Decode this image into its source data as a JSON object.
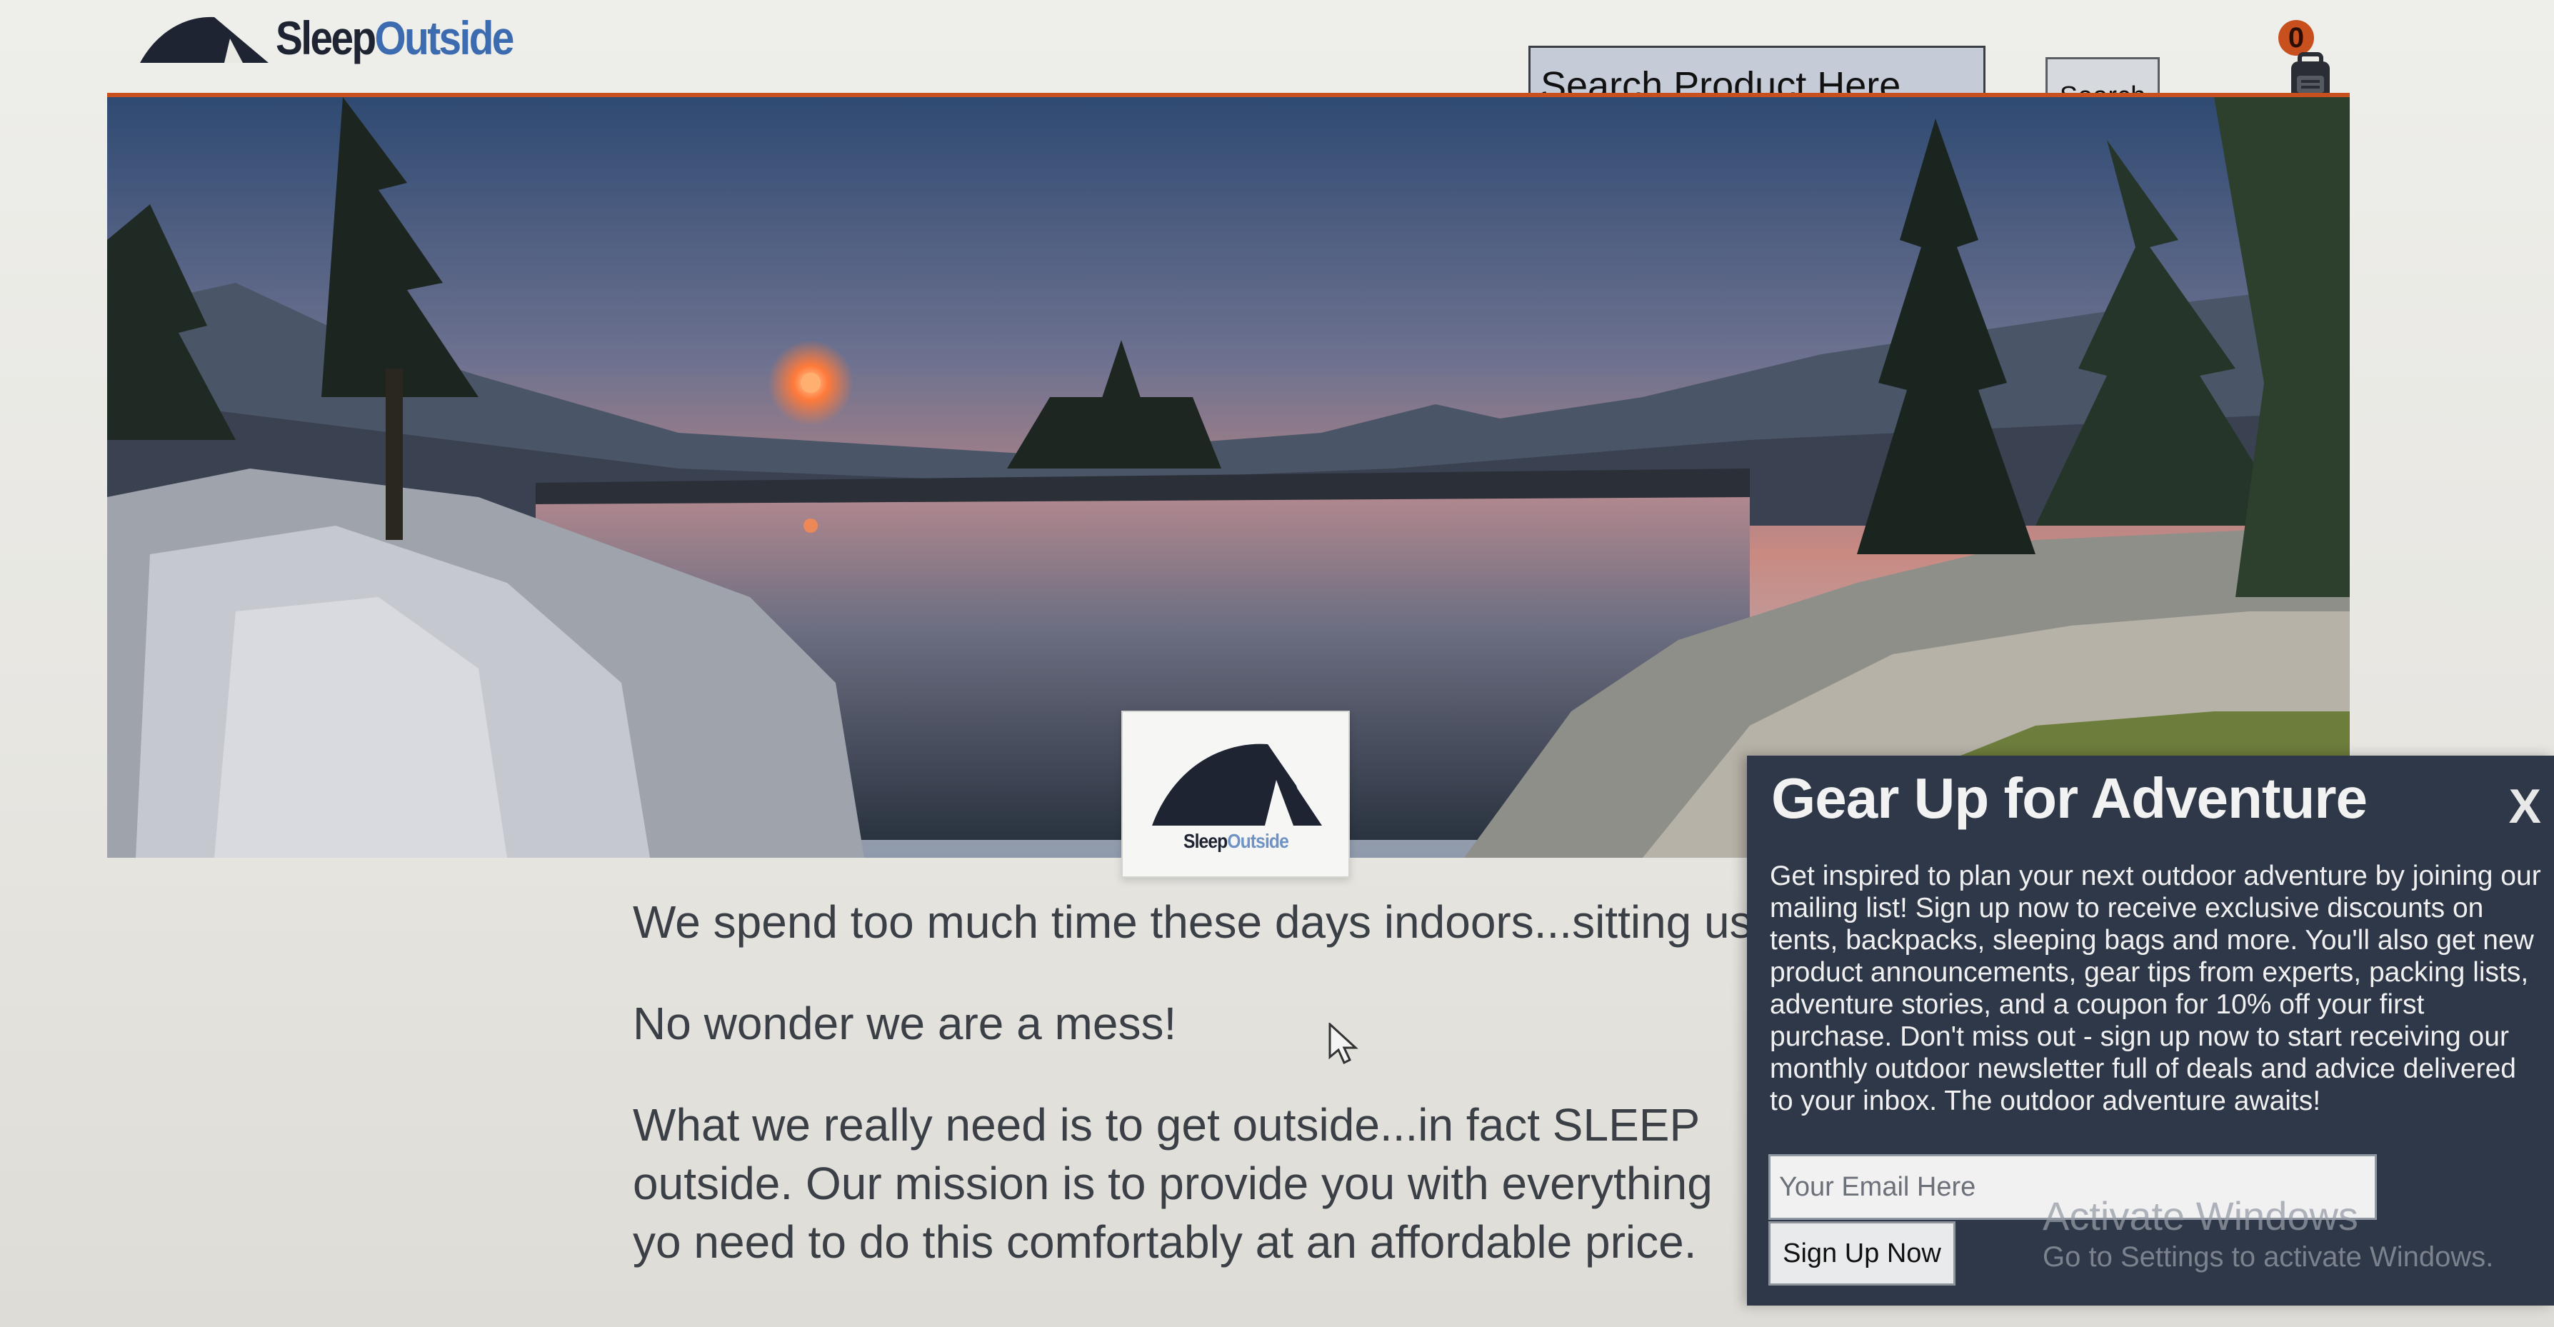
{
  "header": {
    "logo": {
      "word1": "Sleep",
      "word2": "Outside"
    },
    "search": {
      "placeholder": "Search Product Here",
      "button_label": "Search"
    },
    "cart": {
      "count": "0",
      "icon": "backpack-cart-icon"
    }
  },
  "hero": {
    "image": "mountain-lake-sunset-photo",
    "badge": {
      "icon": "tent-logo-icon",
      "word1": "Sleep",
      "word2": "Outside"
    }
  },
  "main": {
    "paragraphs": [
      "We spend too much time these days indoors...sitting usu",
      "No wonder we are a mess!",
      "What we really need is to get outside...in fact SLEEP outside. Our mission is to provide you with everything yo need to do this comfortably at an affordable price."
    ]
  },
  "newsletter": {
    "title": "Gear Up for Adventure",
    "close_label": "X",
    "body": "Get inspired to plan your next outdoor adventure by joining our mailing list! Sign up now to receive exclusive discounts on tents, backpacks, sleeping bags and more. You'll also get new product announcements, gear tips from experts, packing lists, adventure stories, and a coupon for 10% off your first purchase. Don't miss out - sign up now to start receiving our monthly outdoor newsletter full of deals and advice delivered to your inbox. The outdoor adventure awaits!",
    "email_placeholder": "Your Email Here",
    "signup_label": "Sign Up Now"
  },
  "watermark": {
    "title": "Activate Windows",
    "subtitle": "Go to Settings to activate Windows."
  },
  "colors": {
    "accent": "#c8501f",
    "brand_dark": "#1f2433",
    "brand_blue": "#3d6bb0",
    "modal_bg": "#2f3848"
  }
}
